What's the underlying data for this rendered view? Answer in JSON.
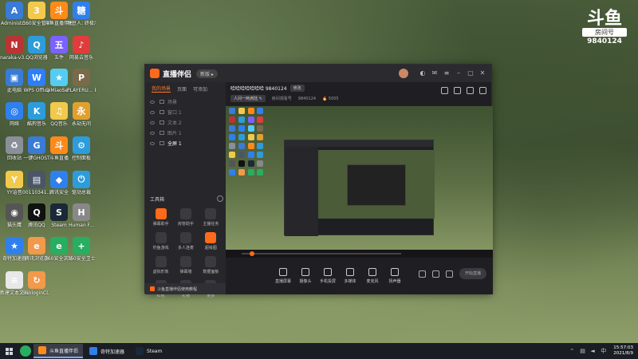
{
  "desktop_icons": [
    {
      "label": "Administr...",
      "color": "#3a7bd5",
      "glyph": "A"
    },
    {
      "label": "360安全管家",
      "color": "#f2c94c",
      "glyph": "3"
    },
    {
      "label": "斗鱼直播伴侣",
      "color": "#ff8a1a",
      "glyph": "斗"
    },
    {
      "label": "糖豆人: 终极淘汰赛",
      "color": "#2f80ed",
      "glyph": "糖"
    },
    {
      "label": "naraka-v3...",
      "color": "#b33",
      "glyph": "N"
    },
    {
      "label": "QQ浏览器",
      "color": "#2d9cdb",
      "glyph": "Q"
    },
    {
      "label": "五件",
      "color": "#7b61ff",
      "glyph": "五"
    },
    {
      "label": "网易云音乐",
      "color": "#e03c3c",
      "glyph": "♪"
    },
    {
      "label": "此电脑",
      "color": "#3a7bd5",
      "glyph": "▣"
    },
    {
      "label": "WPS Office",
      "color": "#2d7ff9",
      "glyph": "W"
    },
    {
      "label": "QiMiaoSe...",
      "color": "#56ccf2",
      "glyph": "★"
    },
    {
      "label": "PLAYERU... BATTLEGR...",
      "color": "#7a6a4a",
      "glyph": "P"
    },
    {
      "label": "网络",
      "color": "#2f80ed",
      "glyph": "◎"
    },
    {
      "label": "酷狗音乐",
      "color": "#2d9cdb",
      "glyph": "K"
    },
    {
      "label": "QQ音乐",
      "color": "#f2c94c",
      "glyph": "♫"
    },
    {
      "label": "永劫无间",
      "color": "#e0a030",
      "glyph": "永"
    },
    {
      "label": "回收站",
      "color": "#8a8f99",
      "glyph": "♻"
    },
    {
      "label": "一键GHOST",
      "color": "#3a7bd5",
      "glyph": "G"
    },
    {
      "label": "斗鱼直播",
      "color": "#ff8a1a",
      "glyph": "斗"
    },
    {
      "label": "控制面板",
      "color": "#2d9cdb",
      "glyph": "⚙"
    },
    {
      "label": "YY语音",
      "color": "#f2c94c",
      "glyph": "Y"
    },
    {
      "label": "00110341...",
      "color": "#4a5568",
      "glyph": "▤"
    },
    {
      "label": "腾讯安全",
      "color": "#2f80ed",
      "glyph": "◆"
    },
    {
      "label": "驱动总裁",
      "color": "#2d9cdb",
      "glyph": "⏻"
    },
    {
      "label": "猫头鹰",
      "color": "#555",
      "glyph": "◉"
    },
    {
      "label": "腾讯QQ",
      "color": "#111",
      "glyph": "Q"
    },
    {
      "label": "Steam",
      "color": "#1b2838",
      "glyph": "S"
    },
    {
      "label": "Human F...",
      "color": "#888",
      "glyph": "H"
    },
    {
      "label": "奇特加速器",
      "color": "#2f80ed",
      "glyph": "★"
    },
    {
      "label": "腾讯浏览器",
      "color": "#f2994a",
      "glyph": "e"
    },
    {
      "label": "360安全浏览器",
      "color": "#27ae60",
      "glyph": "e"
    },
    {
      "label": "360安全卫士",
      "color": "#27ae60",
      "glyph": "+"
    },
    {
      "label": "新建文本文档",
      "color": "#e8e8e8",
      "glyph": "≡"
    },
    {
      "label": "SunloginCl...",
      "color": "#f2994a",
      "glyph": "↻"
    }
  ],
  "watermark": {
    "logo": "斗鱼",
    "room_label": "房间号",
    "room_number": "9840124"
  },
  "app": {
    "name": "直播伴侣",
    "version_badge": "新版 ▸",
    "sidebar_tabs": [
      "我的场景",
      "页面",
      "可添加"
    ],
    "scenes": [
      {
        "label": "场景",
        "active": false
      },
      {
        "label": "窗口 1",
        "active": false
      },
      {
        "label": "文本 2",
        "active": false
      },
      {
        "label": "图片 1",
        "active": false
      },
      {
        "label": "全屏 1",
        "active": true
      }
    ],
    "tools_title": "工具箱",
    "tools": [
      {
        "label": "弹幕助手",
        "hot": true
      },
      {
        "label": "房管助手",
        "hot": false
      },
      {
        "label": "主播任务",
        "hot": false
      },
      {
        "label": "钓鱼游戏",
        "hot": false
      },
      {
        "label": "多人连麦",
        "hot": false
      },
      {
        "label": "超级图",
        "hot": true
      },
      {
        "label": "虚拟形象",
        "hot": false
      },
      {
        "label": "弹幕墙",
        "hot": false
      },
      {
        "label": "数据面板",
        "hot": false
      },
      {
        "label": "红包",
        "hot": false
      },
      {
        "label": "礼物",
        "hot": false
      },
      {
        "label": "更多",
        "hot": false
      }
    ],
    "sidebar_footer": "斗鱼直播伴侣使用教程",
    "room_title": "哈哈哈哈哈哈哈 9840124",
    "edit_label": "修改",
    "category_label": "人间一两滴陆 ✎",
    "room_id_label": "房间观看号",
    "room_id": "9840124",
    "heat": "🔥 5005",
    "controls": [
      {
        "label": "直播屏幕",
        "icon": "screen-icon"
      },
      {
        "label": "摄像头",
        "icon": "camera-icon"
      },
      {
        "label": "手机投屏",
        "icon": "phone-icon"
      },
      {
        "label": "多媒体",
        "icon": "media-icon"
      },
      {
        "label": "麦克风",
        "icon": "mic-icon"
      },
      {
        "label": "扬声器",
        "icon": "speaker-icon"
      }
    ],
    "start_label": "开始直播"
  },
  "taskbar": {
    "tasks": [
      {
        "label": "斗鱼直播伴侣",
        "active": true,
        "color": "#ff8a1a"
      },
      {
        "label": "奇特加速器",
        "active": false,
        "color": "#2f80ed"
      },
      {
        "label": "Steam",
        "active": false,
        "color": "#1b2838"
      }
    ],
    "time": "15:57:03",
    "date": "2021/8/9"
  }
}
